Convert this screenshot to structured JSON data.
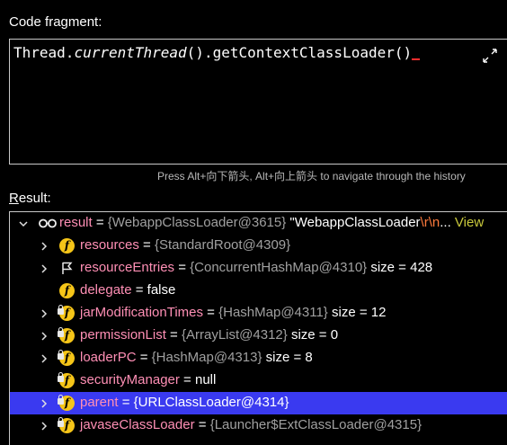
{
  "code_label": "Code fragment:",
  "code": {
    "prefix": "Thread.",
    "method_italic": "currentThread",
    "suffix": "().getContextClassLoader()"
  },
  "hint": "Press Alt+向下箭头, Alt+向上箭头 to navigate through the history",
  "result_label_first": "R",
  "result_label_rest": "esult:",
  "tree": {
    "root": {
      "name": "result",
      "eq": " = ",
      "ref": "{WebappClassLoader@3615}",
      "str_start": " \"WebappClassLoader",
      "escape": "\\r\\n",
      "ellipsis": "... ",
      "view": "View"
    },
    "rows": [
      {
        "name": "resources",
        "eq": " = ",
        "ref": "{StandardRoot@4309}",
        "extra": ""
      },
      {
        "name": "resourceEntries",
        "eq": " = ",
        "ref": "{ConcurrentHashMap@4310}",
        "extra": "  size = 428"
      },
      {
        "name": "delegate",
        "eq": " = ",
        "ref": "false",
        "extra": ""
      },
      {
        "name": "jarModificationTimes",
        "eq": " = ",
        "ref": "{HashMap@4311}",
        "extra": "  size = 12"
      },
      {
        "name": "permissionList",
        "eq": " = ",
        "ref": "{ArrayList@4312}",
        "extra": "  size = 0"
      },
      {
        "name": "loaderPC",
        "eq": " = ",
        "ref": "{HashMap@4313}",
        "extra": "  size = 8"
      },
      {
        "name": "securityManager",
        "eq": " = ",
        "ref": "null",
        "extra": ""
      },
      {
        "name": "parent",
        "eq": " = ",
        "ref": "{URLClassLoader@4314}",
        "extra": ""
      },
      {
        "name": "javaseClassLoader",
        "eq": " = ",
        "ref": "{Launcher$ExtClassLoader@4315}",
        "extra": ""
      }
    ]
  },
  "colors": {
    "background": "#000000",
    "field_name": "#ff8fb5",
    "reference": "#a0a0a0",
    "selection": "#3a3af0",
    "field_icon": "#f5c518",
    "caret": "#ff2d2d"
  },
  "icons": {
    "expand": "expand-arrows-icon",
    "field": "field-f-icon",
    "flag": "flag-icon",
    "lock": "lock-icon",
    "watch": "watch-glasses-icon"
  }
}
